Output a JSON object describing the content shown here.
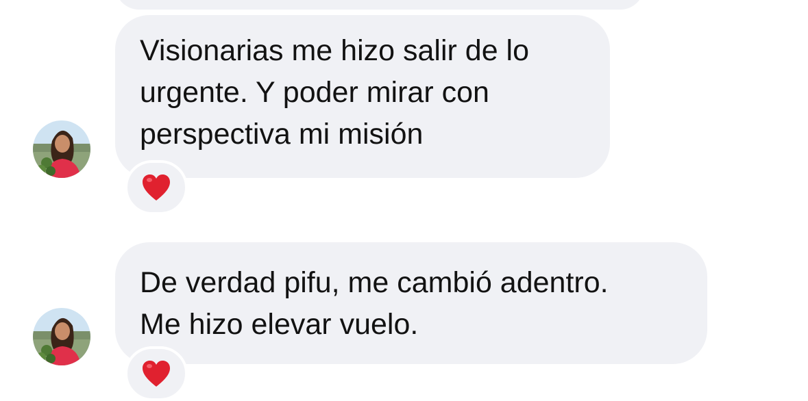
{
  "messages": [
    {
      "lines": [
        "Visionarias me hizo salir de lo",
        "urgente. Y poder mirar con",
        "perspectiva mi misión"
      ],
      "reaction": "heart-icon"
    },
    {
      "lines": [
        "De verdad pifu, me cambió adentro.",
        "Me hizo elevar vuelo."
      ],
      "reaction": "heart-icon"
    }
  ],
  "colors": {
    "bubble": "#f0f1f5",
    "text": "#121212",
    "heart": "#e0212f"
  }
}
